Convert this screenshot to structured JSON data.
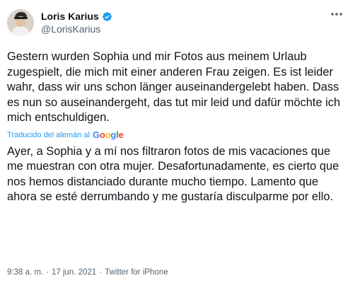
{
  "author": {
    "display_name": "Loris Karius",
    "handle": "@LorisKarius",
    "verified": true
  },
  "menu": {
    "icon": "more-horizontal-icon"
  },
  "tweet": {
    "original_text": "Gestern wurden Sophia und mir Fotos aus meinem Urlaub zugespielt, die mich mit einer anderen Frau zeigen. Es ist leider wahr, dass wir uns schon länger auseinandergelebt haben. Dass es nun so auseinandergeht, das tut mir leid und dafür möchte ich mich entschuldigen.",
    "translation_label": "Traducido del alemán al",
    "translation_provider": "Google",
    "translated_text": "Ayer, a Sophia y a mí nos filtraron fotos de mis vacaciones que me muestran con otra mujer. Desafortunadamente, es cierto que nos hemos distanciado durante mucho tiempo. Lamento que ahora se esté derrumbando y me gustaría disculparme por ello."
  },
  "meta": {
    "time": "9:38 a. m.",
    "date": "17 jun. 2021",
    "separator": "·",
    "source": "Twitter for iPhone"
  },
  "colors": {
    "accent": "#1d9bf0",
    "text": "#0f1419",
    "secondary": "#536471"
  }
}
